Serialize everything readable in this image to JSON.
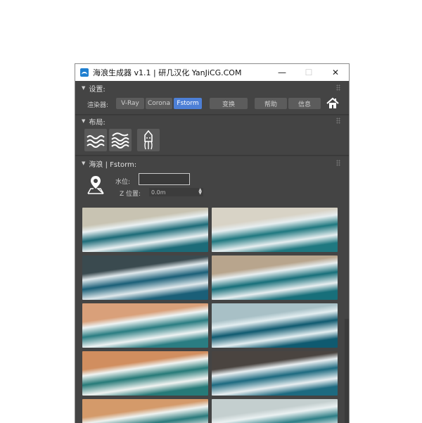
{
  "window": {
    "title": "海浪生成器 v1.1 | 研几汉化 YanJiCG.COM",
    "minimize_glyph": "—",
    "maximize_glyph": "☐",
    "close_glyph": "✕"
  },
  "settings": {
    "header": "设置:",
    "renderer_label": "渲染器:",
    "renderers": [
      "V-Ray",
      "Corona",
      "Fstorm"
    ],
    "active_renderer": "Fstorm",
    "convert_label": "变换",
    "help_label": "帮助",
    "info_label": "信息",
    "home_icon": "home-icon"
  },
  "layout": {
    "header": "布局:",
    "icons": [
      "waves-double-icon",
      "waves-triple-icon",
      "squid-icon"
    ]
  },
  "waves": {
    "header": "海浪 | Fstorm:",
    "water_level_label": "水位:",
    "water_level_value": "",
    "z_position_label": "Z 位置:",
    "z_position_value": "0.0m",
    "location_icon": "map-pin-icon"
  },
  "gallery": {
    "thumbnails": [
      {
        "sand": "#c8c3b2",
        "water": "#1c6b78",
        "foam": "#e9f0f2"
      },
      {
        "sand": "#d8d3c6",
        "water": "#1f7880",
        "foam": "#e6eef0"
      },
      {
        "sand": "#3a4a4f",
        "water": "#1a5f78",
        "foam": "#dfe8ec"
      },
      {
        "sand": "#b8a58d",
        "water": "#176f7a",
        "foam": "#e7eef0"
      },
      {
        "sand": "#d9a07a",
        "water": "#2a7d82",
        "foam": "#eef3f3"
      },
      {
        "sand": "#a8c0c6",
        "water": "#0f5a70",
        "foam": "#e3eef1"
      },
      {
        "sand": "#d18e5f",
        "water": "#267a78",
        "foam": "#f0f3f1"
      },
      {
        "sand": "#4a4440",
        "water": "#1d6a80",
        "foam": "#e8eef1"
      },
      {
        "sand": "#d49a6a",
        "water": "#2a7a7c",
        "foam": "#eef2f0"
      },
      {
        "sand": "#c4cfcf",
        "water": "#2d7e86",
        "foam": "#eaf1f2"
      }
    ]
  }
}
